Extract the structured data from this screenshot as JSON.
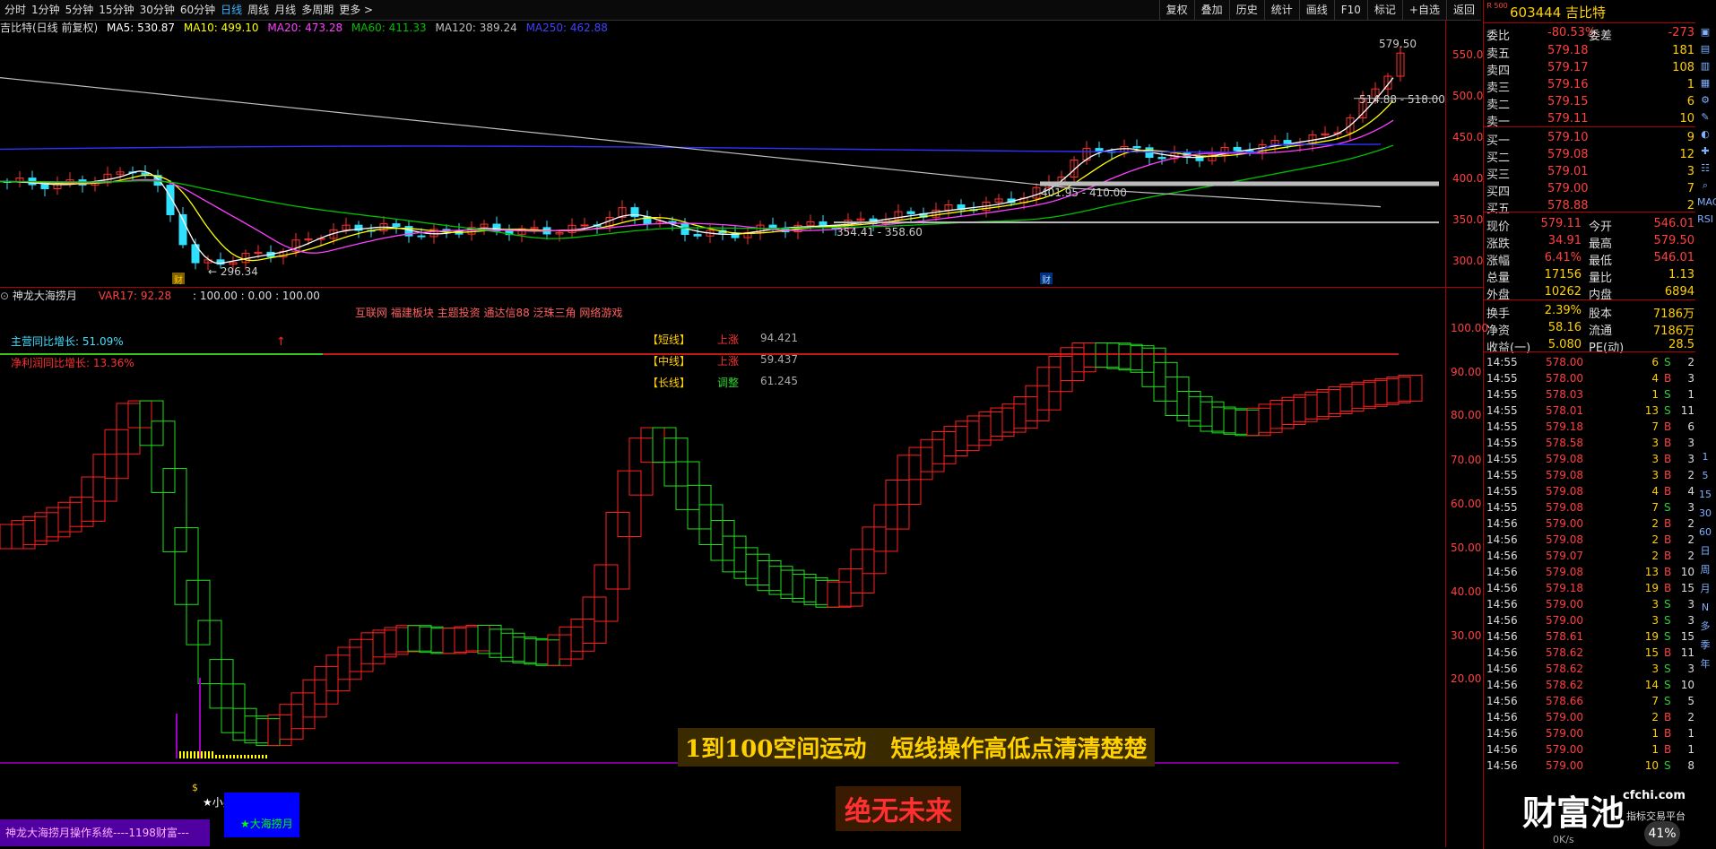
{
  "toolbar": {
    "timeframes": [
      "分时",
      "1分钟",
      "5分钟",
      "15分钟",
      "30分钟",
      "60分钟",
      "日线",
      "周线",
      "月线",
      "多周期",
      "更多 >"
    ],
    "active_timeframe": "日线",
    "right_buttons": [
      "复权",
      "叠加",
      "历史",
      "统计",
      "画线",
      "F10",
      "标记",
      "+自选",
      "返回"
    ]
  },
  "ma_line": {
    "title": "吉比特(日线 前复权)",
    "ma5": "MA5: 530.87",
    "ma10": "MA10: 499.10",
    "ma20": "MA20: 473.28",
    "ma60": "MA60: 411.33",
    "ma120": "MA120: 389.24",
    "ma250": "MA250: 462.88"
  },
  "chart_annotations": {
    "high_label": "579.50",
    "range1": "514.88 - 518.00",
    "range2": "401.95 - 410.00",
    "range3": "354.41 - 358.60",
    "low_label": "296.34",
    "marker_left": "财",
    "marker_right": "财"
  },
  "price_axis": [
    "550.0",
    "500.0",
    "450.0",
    "400.0",
    "350.0",
    "300.0"
  ],
  "indicator_header": {
    "name": "神龙大海捞月",
    "var17": "VAR17: 92.28",
    "vals": ": 100.00 : 0.00 : 100.00"
  },
  "concepts": "互联网 福建板块 主题投资 通达信88 泛珠三角 网络游戏",
  "growth": {
    "revenue": "主营同比增长: 51.09%",
    "profit": "净利润同比增长: 13.36%"
  },
  "trend_table": [
    {
      "name": "【短线】",
      "state": "上涨",
      "value": "94.421",
      "state_color": "#ff3030"
    },
    {
      "name": "【中线】",
      "state": "上涨",
      "value": "59.437",
      "state_color": "#ff3030"
    },
    {
      "name": "【长线】",
      "state": "调整",
      "value": "61.245",
      "state_color": "#30d030"
    }
  ],
  "indicator_axis": [
    "100.00",
    "90.00",
    "80.00",
    "70.00",
    "60.00",
    "50.00",
    "40.00",
    "30.00",
    "20.00"
  ],
  "banner": {
    "main": "1到100空间运动   短线操作高低点清清楚楚",
    "sub": "绝无未来"
  },
  "bottom": {
    "dollar": "$",
    "small_buy": "★小买",
    "system": "神龙大海捞月操作系统----1198财富---",
    "badge": "★大海捞月"
  },
  "watermark": {
    "logo": "财富池",
    "site": "cfchi.com",
    "tagline": "指标交易平台",
    "speed": "0K/s",
    "percent": "41%"
  },
  "quote_panel": {
    "code_prefix": "R 500",
    "code": "603444",
    "name": "吉比特",
    "webi_label": "委比",
    "webi": "-80.53%",
    "wecha_label": "委差",
    "wecha": "-273",
    "asks": [
      {
        "label": "卖五",
        "price": "579.18",
        "vol": "181"
      },
      {
        "label": "卖四",
        "price": "579.17",
        "vol": "108"
      },
      {
        "label": "卖三",
        "price": "579.16",
        "vol": "1"
      },
      {
        "label": "卖二",
        "price": "579.15",
        "vol": "6"
      },
      {
        "label": "卖一",
        "price": "579.11",
        "vol": "10"
      }
    ],
    "bids": [
      {
        "label": "买一",
        "price": "579.10",
        "vol": "9"
      },
      {
        "label": "买二",
        "price": "579.08",
        "vol": "12"
      },
      {
        "label": "买三",
        "price": "579.01",
        "vol": "3"
      },
      {
        "label": "买四",
        "price": "579.00",
        "vol": "7"
      },
      {
        "label": "买五",
        "price": "578.88",
        "vol": "2"
      }
    ],
    "stats": [
      {
        "l1": "现价",
        "v1": "579.11",
        "l2": "今开",
        "v2": "546.01"
      },
      {
        "l1": "涨跌",
        "v1": "34.91",
        "l2": "最高",
        "v2": "579.50"
      },
      {
        "l1": "涨幅",
        "v1": "6.41%",
        "l2": "最低",
        "v2": "546.01"
      },
      {
        "l1": "总量",
        "v1": "17156",
        "l2": "量比",
        "v2": "1.13"
      },
      {
        "l1": "外盘",
        "v1": "10262",
        "l2": "内盘",
        "v2": "6894"
      }
    ],
    "stats2": [
      {
        "l1": "换手",
        "v1": "2.39%",
        "l2": "股本",
        "v2": "7186万"
      },
      {
        "l1": "净资",
        "v1": "58.16",
        "l2": "流通",
        "v2": "7186万"
      },
      {
        "l1": "收益(一)",
        "v1": "5.080",
        "l2": "PE(动)",
        "v2": "28.5"
      }
    ]
  },
  "ticks": [
    {
      "time": "14:55",
      "price": "578.00",
      "vol": "6",
      "bs": "S",
      "n": "2"
    },
    {
      "time": "14:55",
      "price": "578.00",
      "vol": "4",
      "bs": "B",
      "n": "3"
    },
    {
      "time": "14:55",
      "price": "578.03",
      "vol": "1",
      "bs": "S",
      "n": "1"
    },
    {
      "time": "14:55",
      "price": "578.01",
      "vol": "13",
      "bs": "S",
      "n": "11"
    },
    {
      "time": "14:55",
      "price": "579.18",
      "vol": "7",
      "bs": "B",
      "n": "6"
    },
    {
      "time": "14:55",
      "price": "578.58",
      "vol": "3",
      "bs": "B",
      "n": "3"
    },
    {
      "time": "14:55",
      "price": "579.08",
      "vol": "3",
      "bs": "B",
      "n": "3"
    },
    {
      "time": "14:55",
      "price": "579.08",
      "vol": "3",
      "bs": "B",
      "n": "2"
    },
    {
      "time": "14:55",
      "price": "579.08",
      "vol": "4",
      "bs": "B",
      "n": "4"
    },
    {
      "time": "14:55",
      "price": "579.08",
      "vol": "7",
      "bs": "S",
      "n": "3"
    },
    {
      "time": "14:56",
      "price": "579.00",
      "vol": "2",
      "bs": "B",
      "n": "2"
    },
    {
      "time": "14:56",
      "price": "579.08",
      "vol": "2",
      "bs": "B",
      "n": "2"
    },
    {
      "time": "14:56",
      "price": "579.07",
      "vol": "2",
      "bs": "B",
      "n": "2"
    },
    {
      "time": "14:56",
      "price": "579.08",
      "vol": "13",
      "bs": "B",
      "n": "10"
    },
    {
      "time": "14:56",
      "price": "579.18",
      "vol": "19",
      "bs": "B",
      "n": "15"
    },
    {
      "time": "14:56",
      "price": "579.00",
      "vol": "3",
      "bs": "S",
      "n": "3"
    },
    {
      "time": "14:56",
      "price": "579.00",
      "vol": "3",
      "bs": "S",
      "n": "3"
    },
    {
      "time": "14:56",
      "price": "578.61",
      "vol": "19",
      "bs": "S",
      "n": "15"
    },
    {
      "time": "14:56",
      "price": "578.62",
      "vol": "15",
      "bs": "B",
      "n": "11"
    },
    {
      "time": "14:56",
      "price": "578.62",
      "vol": "3",
      "bs": "S",
      "n": "3"
    },
    {
      "time": "14:56",
      "price": "578.62",
      "vol": "14",
      "bs": "S",
      "n": "10"
    },
    {
      "time": "14:56",
      "price": "578.66",
      "vol": "7",
      "bs": "S",
      "n": "5"
    },
    {
      "time": "14:56",
      "price": "579.00",
      "vol": "2",
      "bs": "B",
      "n": "2"
    },
    {
      "time": "14:56",
      "price": "579.00",
      "vol": "1",
      "bs": "B",
      "n": "1"
    },
    {
      "time": "14:56",
      "price": "579.00",
      "vol": "1",
      "bs": "B",
      "n": "1"
    },
    {
      "time": "14:56",
      "price": "579.00",
      "vol": "10",
      "bs": "S",
      "n": "8"
    }
  ],
  "side_icons": [
    "▣",
    "▤",
    "▥",
    "▦",
    "⚙",
    "✎",
    "◐",
    "✚",
    "☷",
    "⌕",
    "MACD",
    "RSI"
  ],
  "side_labels": [
    "1",
    "5",
    "15",
    "30",
    "60",
    "日",
    "周",
    "月",
    "N",
    "多",
    "季",
    "年"
  ],
  "colors": {
    "up": "#ff3030",
    "down": "#30d030",
    "ma5": "#ffffff",
    "ma10": "#ffff00",
    "ma20": "#ff40ff",
    "ma60": "#00c000",
    "ma120": "#c0c0c0",
    "ma250": "#4040ff",
    "accent": "#ffd000"
  }
}
